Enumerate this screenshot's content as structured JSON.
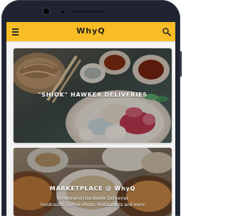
{
  "app": {
    "name": "WhyQ"
  },
  "header": {
    "menu_icon": "hamburger-menu-icon",
    "search_icon": "search-icon",
    "background_color": "#f8bd24"
  },
  "cards": [
    {
      "title": "\"SHIOK\" HAWKER DELIVERIES"
    },
    {
      "title": "MARKETPLACE @ WhyQ",
      "subtitle_lines": [
        "On-demand islandwide Deliveries",
        "Foodcourts, Coffee shops, Restaurants and more"
      ]
    }
  ]
}
